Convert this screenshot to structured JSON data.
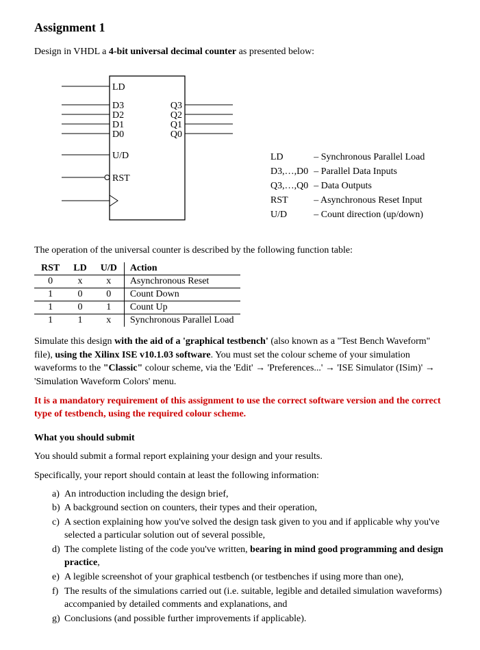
{
  "title": "Assignment 1",
  "intro_prefix": "Design in VHDL a ",
  "intro_bold": "4-bit universal decimal counter",
  "intro_suffix": " as presented below:",
  "diagram": {
    "ld": "LD",
    "d3": "D3",
    "d2": "D2",
    "d1": "D1",
    "d0": "D0",
    "q3": "Q3",
    "q2": "Q2",
    "q1": "Q1",
    "q0": "Q0",
    "ud": "U/D",
    "rst": "RST"
  },
  "signal_defs": [
    {
      "sig": "LD",
      "desc": "– Synchronous Parallel Load"
    },
    {
      "sig": "D3,…,D0",
      "desc": "– Parallel Data Inputs"
    },
    {
      "sig": "Q3,…,Q0",
      "desc": "– Data Outputs"
    },
    {
      "sig": "RST",
      "desc": "– Asynchronous Reset Input"
    },
    {
      "sig": "U/D",
      "desc": "– Count direction (up/down)"
    }
  ],
  "table_intro": "The operation of the universal counter is described by the following function table:",
  "table": {
    "headers": [
      "RST",
      "LD",
      "U/D",
      "Action"
    ],
    "rows": [
      {
        "rst": "0",
        "ld": "x",
        "ud": "x",
        "action": "Asynchronous Reset"
      },
      {
        "rst": "1",
        "ld": "0",
        "ud": "0",
        "action": "Count Down"
      },
      {
        "rst": "1",
        "ld": "0",
        "ud": "1",
        "action": "Count Up"
      },
      {
        "rst": "1",
        "ld": "1",
        "ud": "x",
        "action": "Synchronous Parallel Load"
      }
    ]
  },
  "sim_para_1a": "Simulate this design ",
  "sim_para_1b": "with the aid of a 'graphical testbench'",
  "sim_para_1c": " (also known as a \"Test Bench Waveform\" file), ",
  "sim_para_1d": "using the Xilinx ISE v10.1.03 software",
  "sim_para_1e": ". You must set the colour scheme of your simulation waveforms to the ",
  "sim_para_1f": "\"Classic\"",
  "sim_para_1g": " colour scheme, via the 'Edit' → 'Preferences...' → 'ISE Simulator (ISim)' → 'Simulation Waveform Colors' menu.",
  "mandatory": "It is a mandatory requirement of this assignment to use the correct software version and the correct type of testbench, using the required colour scheme.",
  "submit_head": "What you should submit",
  "submit_intro": "You should submit a formal report explaining your design and your results.",
  "submit_spec": "Specifically, your report should contain at least the following information:",
  "items": [
    {
      "m": "a)",
      "pre": "An introduction including the design brief,",
      "bold": "",
      "post": ""
    },
    {
      "m": "b)",
      "pre": "A background section on counters, their types and their operation,",
      "bold": "",
      "post": ""
    },
    {
      "m": "c)",
      "pre": "A section explaining how you've solved the design task given to you and if applicable why you've selected a particular solution out of several possible,",
      "bold": "",
      "post": ""
    },
    {
      "m": "d)",
      "pre": "The complete listing of the code you've written, ",
      "bold": "bearing in mind good programming and design practice",
      "post": ","
    },
    {
      "m": "e)",
      "pre": "A legible screenshot of your graphical testbench (or testbenches if using more than one),",
      "bold": "",
      "post": ""
    },
    {
      "m": "f)",
      "pre": "The results of the simulations carried out (i.e. suitable, legible and detailed simulation waveforms) accompanied by detailed comments and explanations, and",
      "bold": "",
      "post": ""
    },
    {
      "m": "g)",
      "pre": "Conclusions (and possible further improvements if applicable).",
      "bold": "",
      "post": ""
    }
  ]
}
